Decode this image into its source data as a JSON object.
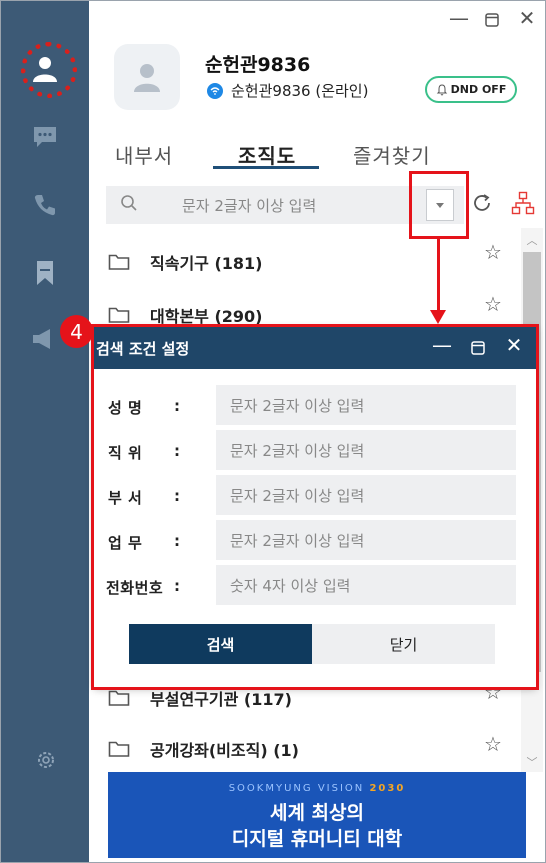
{
  "window": {
    "controls": [
      "minimize-icon",
      "maximize-icon",
      "close-icon"
    ]
  },
  "sidebar": {
    "items": [
      "person-icon",
      "chat-icon",
      "phone-icon",
      "bookmark-icon",
      "megaphone-icon"
    ],
    "footer": "gear-icon"
  },
  "profile": {
    "name": "순헌관9836",
    "status_text": "순헌관9836 (온라인)",
    "dnd_label": "DND OFF"
  },
  "tabs": [
    {
      "label": "내부서"
    },
    {
      "label": "조직도",
      "active": true
    },
    {
      "label": "즐겨찾기"
    }
  ],
  "search": {
    "placeholder": "문자 2글자 이상 입력"
  },
  "org_list": [
    {
      "label": "직속기구 (181)"
    },
    {
      "label": "대학본부 (290)"
    },
    {
      "label": "부설연구기관 (117)"
    },
    {
      "label": "공개강좌(비조직) (1)"
    }
  ],
  "annotation": {
    "step_number": "4",
    "color": "#e5131a"
  },
  "dialog": {
    "title": "검색 조건 설정",
    "fields": [
      {
        "label": "성  명",
        "colon": ":",
        "placeholder": "문자 2글자 이상 입력"
      },
      {
        "label": "직  위",
        "colon": ":",
        "placeholder": "문자 2글자 이상 입력"
      },
      {
        "label": "부  서",
        "colon": ":",
        "placeholder": "문자 2글자 이상 입력"
      },
      {
        "label": "업  무",
        "colon": ":",
        "placeholder": "문자 2글자 이상 입력"
      },
      {
        "label": "전화번호",
        "colon": ":",
        "placeholder": "숫자 4자 이상 입력"
      }
    ],
    "search_button": "검색",
    "close_button": "닫기"
  },
  "banner": {
    "tagline_prefix": "SOOKMYUNG VISION",
    "tagline_year": "2030",
    "line1": "세계 최상의",
    "line2": "디지털 휴머니티 대학"
  },
  "colors": {
    "sidebar": "#3d5a76",
    "dialog_header": "#1f4668",
    "primary_button": "#0f3a5e",
    "banner": "#1a55b8",
    "online": "#1e88e5",
    "dnd_border": "#3ac08a"
  }
}
